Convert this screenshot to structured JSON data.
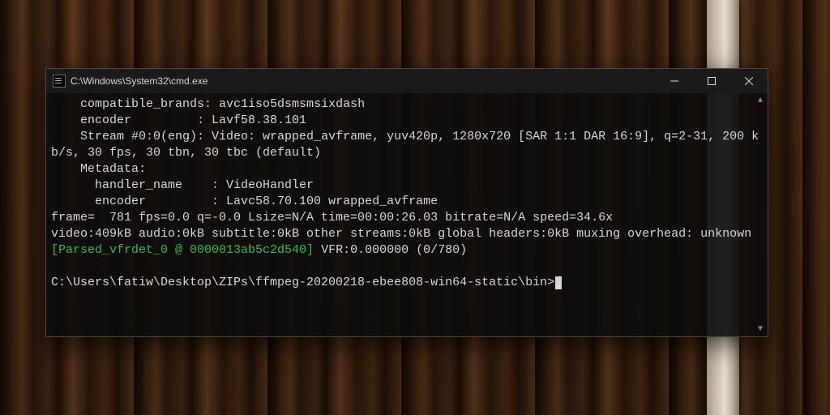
{
  "window": {
    "title": "C:\\Windows\\System32\\cmd.exe"
  },
  "terminal": {
    "lines": {
      "l1": "    compatible_brands: avc1iso5dsmsmsixdash",
      "l2": "    encoder         : Lavf58.38.101",
      "l3": "    Stream #0:0(eng): Video: wrapped_avframe, yuv420p, 1280x720 [SAR 1:1 DAR 16:9], q=2-31, 200 kb/s, 30 fps, 30 tbn, 30 tbc (default)",
      "l4": "    Metadata:",
      "l5": "      handler_name    : VideoHandler",
      "l6": "      encoder         : Lavc58.70.100 wrapped_avframe",
      "l7": "frame=  781 fps=0.0 q=-0.0 Lsize=N/A time=00:00:26.03 bitrate=N/A speed=34.6x",
      "l8": "video:409kB audio:0kB subtitle:0kB other streams:0kB global headers:0kB muxing overhead: unknown",
      "l9g": "[Parsed_vfrdet_0 @ 0000013ab5c2d540]",
      "l9r": " VFR:0.000000 (0/780)",
      "blank": "",
      "prompt": "C:\\Users\\fatiw\\Desktop\\ZIPs\\ffmpeg-20200218-ebee808-win64-static\\bin>"
    }
  }
}
